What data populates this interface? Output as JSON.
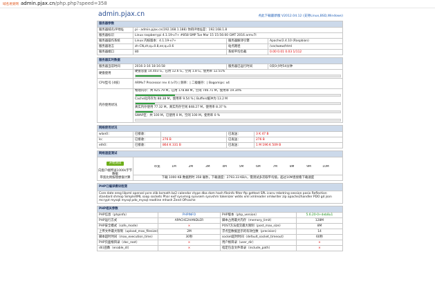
{
  "urlbar": {
    "secure_label": "域名易受网",
    "host": "admin.pjax.cn",
    "path": "/php.php?speed=358"
  },
  "header": {
    "site": "admin.pjax.cn",
    "version_link": "点此下载最新版 V2012.04.12 (支持Linux,BSD,Windows)"
  },
  "server_params": {
    "title": "服务器参数",
    "rows": [
      [
        "服务器域名/IP地址",
        "pi - admin.pjax.cn(192.168.1.188)  你的IP地址是：192.168.1.8",
        "",
        ""
      ],
      [
        "服务器标识",
        "Linux raspberrypi 4.1.19-v7+ #858 SMP Tue Mar 15 15:56:00 GMT 2016 armv7l",
        "",
        ""
      ],
      [
        "服务器操作系统",
        "Linux  内核版本：4.1.19-v7+",
        "服务器解译引擎",
        "Apache/2.4.10 (Raspbian)"
      ],
      [
        "服务器语言",
        "zh-CN,zh;q=0.8,en;q=0.6",
        "站点路径",
        "/var/www/html"
      ],
      [
        "服务器端口",
        "80",
        "系统平均负载",
        "0.00 0.01 0.03 1/112"
      ]
    ]
  },
  "realtime": {
    "title": "服务器实时数据",
    "time_label": "服务器当前时间",
    "time": "2016-3-16 18:16:58",
    "uptime_label": "服务器已运行时间",
    "uptime": "0天0小时54分钟",
    "disk_label": "硬盘使用",
    "disk_text": "硬盘总量 14.403 G，已用 12.6 G，空闲 1.8 G，使用率 12.51%",
    "disk_pct": 12.51,
    "cpu_label": "CPU型号 [4核]",
    "cpu_text": "ARMv7 Processor rev 4 (v7l) | 频率：| 二级缓存：| Bogomips: x4",
    "mem_label": "内存使用状况",
    "mem_phys": "物理内存：共 925.79 M，已用 178.88 M，空闲 746.71 M，使用率 19.34%",
    "mem_phys_pct": 19.34,
    "mem_cache": "Cache化内存为 88.38 M，使用率 9.54 % | Buffers缓冲为 13.2 M",
    "mem_cache_pct": 9.54,
    "mem_real": "真实内存使用 77.32 M，真实内存空闲 848.27 M，使用率 8.37 %",
    "mem_real_pct": 8.37,
    "swap": "SWAP区：共 100 M，已使用 0 M，空闲 100 M，使用率 0 %",
    "swap_pct": 0
  },
  "network": {
    "title": "网络使用状况",
    "rows": [
      {
        "iface": "wlan0：",
        "in_label": "已接收：",
        "in": "",
        "out_label": "已发送：",
        "out": "3 K   47 B"
      },
      {
        "iface": "lo：",
        "in_label": "已接收：",
        "in": "276 B",
        "out_label": "已发送：",
        "out": "276 B"
      },
      {
        "iface": "eth0：",
        "in_label": "已接收：",
        "in": "864 K   331 B",
        "out_label": "已发送：",
        "out": "1 M   196 K   509 B"
      }
    ]
  },
  "speed": {
    "title": "网络速度测试",
    "button": "开始测试",
    "desc": "向客户端传送1000k字节数据\n带宽比例按理想值计算",
    "scale": [
      "带宽",
      "1M",
      "2M",
      "3M",
      "4M",
      "5M",
      "6M",
      "7M",
      "8M",
      "9M",
      "10M"
    ],
    "result": "下载 1000 KB 数据用时 358 毫秒，下载速度：2793.33 KB/s，需测试多次取平均值，超过10M直接看下载速度"
  },
  "modules": {
    "title": "PHP已编译模块检测",
    "text": "Core  date  ereg  libxml  openssl  pcre  zlib  bcmath  bz2  calendar  ctype  dba  dom  hash  fileinfo  filter  ftp  gettext  SPL  iconv  mbstring  session  posix  Reflection  standard  shmop  SimpleXML  soap  sockets  Phar  exif  sysvmsg  sysvsem  sysvshm  tokenizer  wddx  xml  xmlreader  xmlwriter  zip  apache2handler  PDO  gd  json  mcrypt  mysqli  mysql  pdo_mysql  readline  mhash  Zend OPcache"
  },
  "php": {
    "title": "PHP相关参数",
    "rows": [
      [
        "PHP信息（phpinfo）",
        "PHPINFO",
        "PHP版本（php_version）",
        "5.6.20-0+deb8u1"
      ],
      [
        "PHP运行方式",
        "APACHE2HANDLER",
        "脚本占用最大内存（memory_limit）",
        "128M"
      ],
      [
        "PHP安全模式（safe_mode）",
        "×",
        "POST方法提交最大限制（post_max_size）",
        "8M"
      ],
      [
        "上传文件最大限制（upload_max_filesize）",
        "2M",
        "浮点型数据显示的有效位数（precision）",
        "14"
      ],
      [
        "脚本超时时间（max_execution_time）",
        "30秒",
        "socket超时时间（default_socket_timeout）",
        "60秒"
      ],
      [
        "PHP页面根目录（doc_root）",
        "×",
        "用户根目录（user_dir）",
        "×"
      ],
      [
        "dl()函数（enable_dl）",
        "×",
        "指定包含文件目录（include_path）",
        "×"
      ]
    ]
  },
  "colors": {
    "section_bg": "#ccd9ea",
    "bar_green": "#2d9f3d",
    "red": "#dd0000",
    "link": "#1a5bb5"
  }
}
